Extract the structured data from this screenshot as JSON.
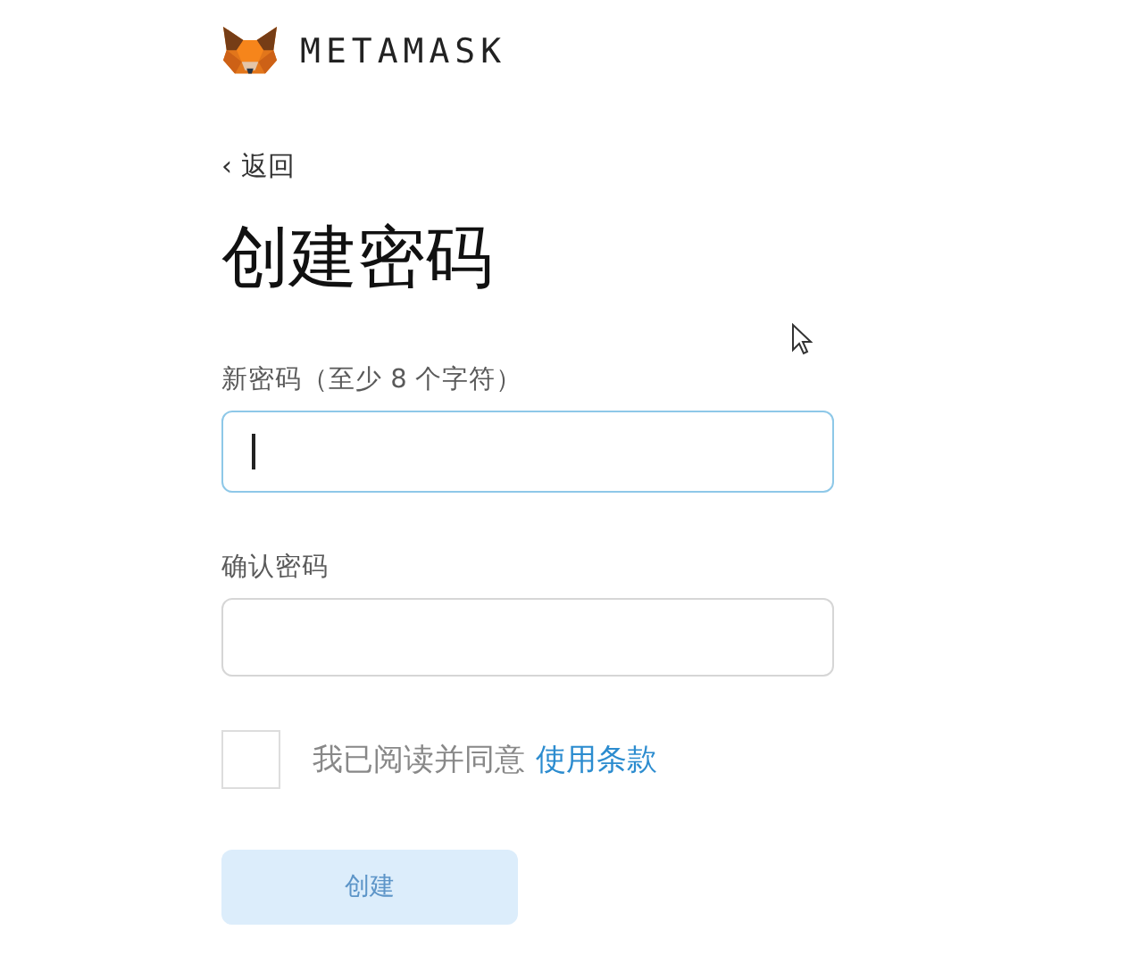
{
  "logo": {
    "wordmark": "METAMASK"
  },
  "back_link": {
    "arrow": "‹",
    "label": "返回"
  },
  "title": "创建密码",
  "fields": [
    {
      "label": "新密码（至少 8 个字符）",
      "focused": true
    },
    {
      "label": "确认密码",
      "focused": false
    }
  ],
  "terms": {
    "checked": false,
    "text": "我已阅读并同意",
    "link": "使用条款"
  },
  "create_button": {
    "label": "创建",
    "disabled": true
  }
}
